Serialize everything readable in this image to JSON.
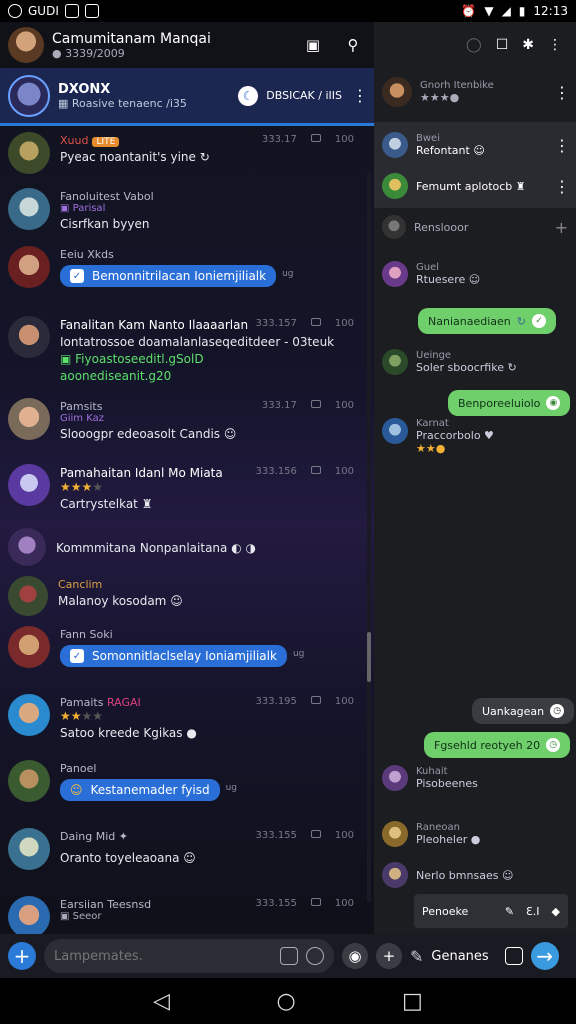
{
  "status": {
    "left_icons": [
      "whatsapp-icon",
      "gallery-icon",
      "vpn-icon"
    ],
    "left_text": "GUDI",
    "time": "12:13"
  },
  "header": {
    "title": "Camumitanam Manqai",
    "subtitle": "● 3339/2009"
  },
  "pinned": {
    "title": "DXONX",
    "subtitle": "▦ Roasive tenaenc /i35",
    "right_text": "DBSICAK / iIIS"
  },
  "chats": [
    {
      "name": "Xuud",
      "badge": "LITE",
      "name_color": "red",
      "msg": "Pyeac noantanit's yine ↻",
      "time": "333.17",
      "count": "100"
    },
    {
      "name": "Fanoluitest Vabol",
      "tag": "▣ Parisal",
      "msg": "Cisrfkan byyen"
    },
    {
      "name": "Eeiu Xkds",
      "bubble": "Bemonnitrilacan Ioniemjilialk",
      "bubble_sub": "ug"
    },
    {
      "name": "Fanalitan Kam Nanto Ilaaaarlan",
      "msg": "Iontatrossoe doamalanlaseqeditdeer - 03teuk",
      "line3": "▣ Fiyoastoseeditl.gSolD",
      "line4": "aoonediseanit.g20",
      "time": "333.157",
      "count": "100"
    },
    {
      "name": "Pamsits",
      "tag": "Giim Kaz",
      "msg": "Slooogpr edeoasolt Candis ☺",
      "time": "333.17",
      "count": "100"
    },
    {
      "name": "Pamahaitan Idanl Mo Miata",
      "stars": 3,
      "msg": "Cartrystelkat ♜",
      "time": "333.156",
      "count": "100"
    },
    {
      "name": "Kommmitana Nonpanlaitana ◐ ◑"
    },
    {
      "name": "Canclim",
      "name_color": "gold",
      "msg": "Malanoy kosodam ☺"
    },
    {
      "name": "Fann Soki",
      "bubble": "Somonnitlaclselay Ioniamjilialk",
      "bubble_sub": "ug"
    },
    {
      "name": "Pamaits",
      "badge_text": "RAGAI",
      "stars": 2,
      "msg": "Satoo kreede Kgikas ●",
      "time": "333.195",
      "count": "100"
    },
    {
      "name": "Panoel",
      "bubble": "Kestanemader fyisd",
      "bubble_sub": "ug",
      "bubble_icon": "☺"
    },
    {
      "name": "Daing Mid ✦",
      "msg": "Oranto toyeleaoana ☺",
      "time": "333.155",
      "count": "100"
    },
    {
      "name": "Earsiian Teesnsd",
      "tag": "▣ Seeor",
      "time": "333.155",
      "count": "100"
    }
  ],
  "right_panel": {
    "contacts": [
      {
        "a": "Gnorh Itenbike",
        "b": "★★★●"
      },
      {
        "a": "Bwei",
        "b": "Refontant ☺"
      },
      {
        "a": "",
        "b": "Femumt aplotocb ♜"
      },
      {
        "a": "",
        "b": "Renslooor"
      }
    ],
    "messages": [
      {
        "a": "Guel",
        "b": "Rtuesere ☺"
      },
      {
        "a": "Ueinge",
        "b": "Soler sboocrfike ↻"
      },
      {
        "a": "Karnat",
        "b": "Praccorbolo ♥",
        "c": "★★●"
      },
      {
        "a": "Kuhait",
        "b": "Pisobeenes"
      },
      {
        "a": "Raneoan",
        "b": "Pleoheler ●"
      },
      {
        "a": "",
        "b": "Nerlo bmnsaes ☺"
      }
    ],
    "bubbles": {
      "b1": "Nanianaediaen",
      "b2": "Benporeeluiolo",
      "b3": "Uankagean",
      "b4": "Fgsehld reotyeh 20"
    },
    "toolbar": "Penoeke"
  },
  "bottom": {
    "placeholder": "Lampemates.",
    "label": "Genanes"
  }
}
